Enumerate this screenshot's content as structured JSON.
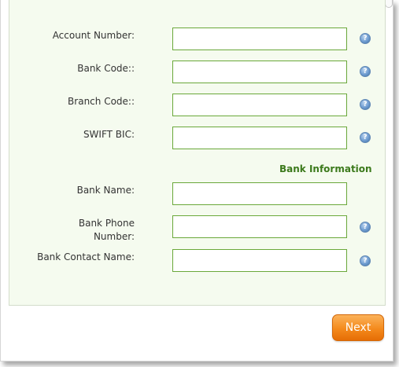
{
  "form": {
    "fields": [
      {
        "label": "Account Number:",
        "value": "",
        "help": "?"
      },
      {
        "label": "Bank Code::",
        "value": "",
        "help": "?"
      },
      {
        "label": "Branch Code::",
        "value": "",
        "help": "?"
      },
      {
        "label": "SWIFT BIC:",
        "value": "",
        "help": "?"
      }
    ],
    "section_title": "Bank Information",
    "bank_fields": [
      {
        "label": "Bank Name:",
        "value": ""
      },
      {
        "label": "Bank Phone Number:",
        "value": "",
        "help": "?"
      },
      {
        "label": "Bank Contact Name:",
        "value": "",
        "help": "?"
      }
    ]
  },
  "footer": {
    "next_label": "Next"
  },
  "colors": {
    "panel_background": "#f5fbef",
    "field_border": "#6aa83a",
    "section_title": "#3c7a1c",
    "next_button": "#f48a1c"
  },
  "icons": {
    "help": "help-icon"
  }
}
